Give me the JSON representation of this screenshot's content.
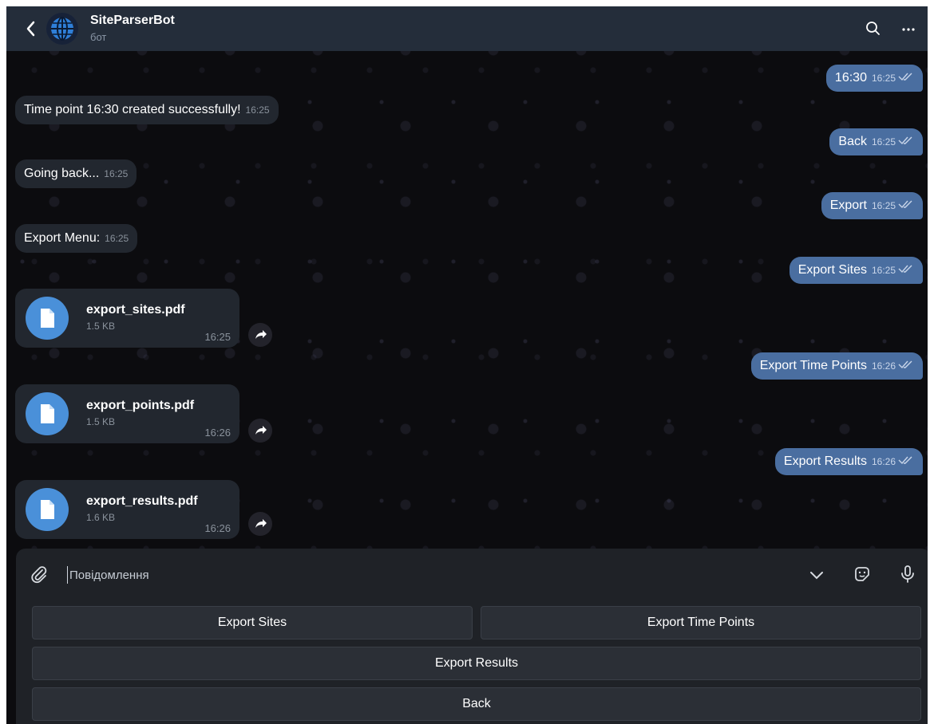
{
  "header": {
    "title": "SiteParserBot",
    "subtitle": "бот"
  },
  "messages_in": [
    {
      "text": "Time point 16:30 created successfully!",
      "time": "16:25"
    },
    {
      "text": "Going back...",
      "time": "16:25"
    },
    {
      "text": "Export Menu:",
      "time": "16:25"
    }
  ],
  "messages_out": [
    {
      "text": "16:30",
      "time": "16:25"
    },
    {
      "text": "Back",
      "time": "16:25"
    },
    {
      "text": "Export",
      "time": "16:25"
    },
    {
      "text": "Export Sites",
      "time": "16:25"
    },
    {
      "text": "Export Time Points",
      "time": "16:26"
    },
    {
      "text": "Export Results",
      "time": "16:26"
    }
  ],
  "files": [
    {
      "name": "export_sites.pdf",
      "size": "1.5 KB",
      "time": "16:25"
    },
    {
      "name": "export_points.pdf",
      "size": "1.5 KB",
      "time": "16:26"
    },
    {
      "name": "export_results.pdf",
      "size": "1.6 KB",
      "time": "16:26"
    }
  ],
  "composer": {
    "placeholder": "Повідомлення"
  },
  "keyboard": {
    "export_sites": "Export Sites",
    "export_time_points": "Export Time Points",
    "export_results": "Export Results",
    "back": "Back"
  },
  "colors": {
    "header_bg": "#242d3a",
    "incoming_bubble": "#22272f",
    "outgoing_bubble": "#4a6ea0",
    "file_icon": "#4a90d9"
  },
  "icons": [
    "back-arrow-icon",
    "globe-avatar-icon",
    "search-icon",
    "more-icon",
    "file-icon",
    "share-icon",
    "attach-icon",
    "chevron-down-icon",
    "sticker-icon",
    "microphone-icon",
    "double-check-icon"
  ]
}
